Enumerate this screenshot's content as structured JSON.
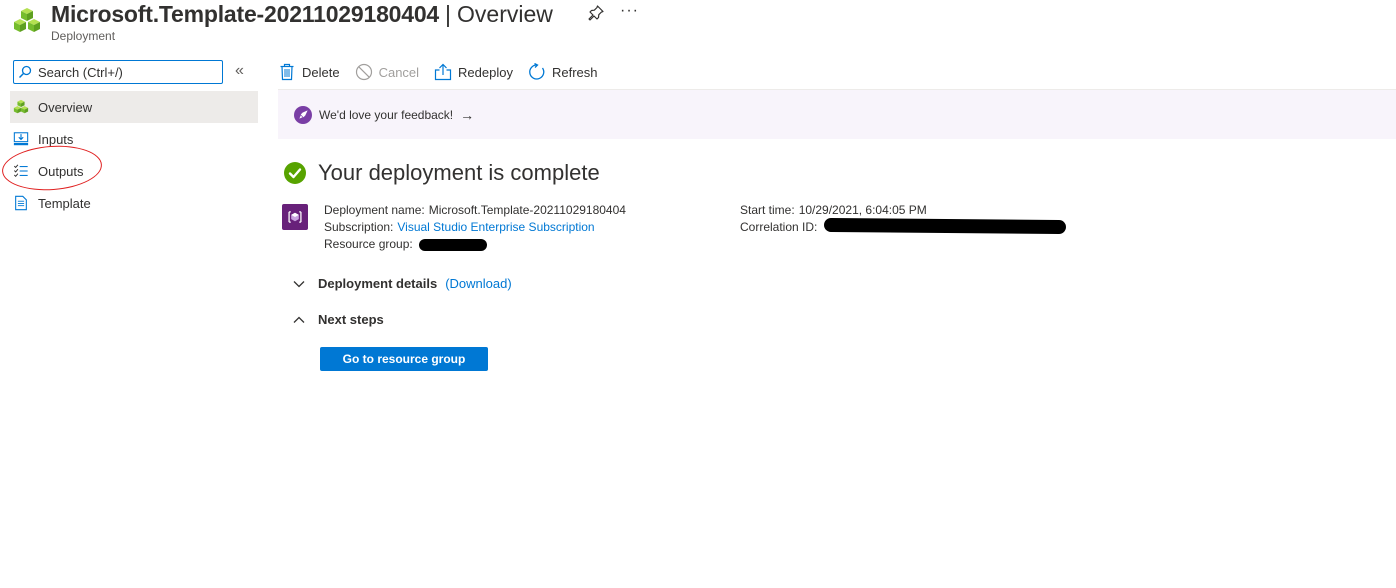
{
  "header": {
    "title": "Microsoft.Template-20211029180404",
    "separator": "|",
    "section": "Overview",
    "subtitle": "Deployment",
    "more": "···"
  },
  "sidebar": {
    "search_placeholder": "Search (Ctrl+/)",
    "collapse": "«",
    "items": [
      {
        "label": "Overview",
        "icon": "deployment-icon",
        "active": true
      },
      {
        "label": "Inputs",
        "icon": "inputs-icon",
        "active": false
      },
      {
        "label": "Outputs",
        "icon": "outputs-icon",
        "active": false
      },
      {
        "label": "Template",
        "icon": "template-icon",
        "active": false
      }
    ]
  },
  "toolbar": {
    "delete": "Delete",
    "cancel": "Cancel",
    "redeploy": "Redeploy",
    "refresh": "Refresh"
  },
  "feedback": {
    "text": "We'd love your feedback!",
    "arrow": "→"
  },
  "main": {
    "status_title": "Your deployment is complete",
    "deployment_name_label": "Deployment name:",
    "deployment_name": "Microsoft.Template-20211029180404",
    "subscription_label": "Subscription:",
    "subscription": "Visual Studio Enterprise Subscription",
    "resource_group_label": "Resource group:",
    "start_time_label": "Start time:",
    "start_time": "10/29/2021, 6:04:05 PM",
    "correlation_id_label": "Correlation ID:",
    "deployment_details_label": "Deployment details",
    "download_link": "(Download)",
    "next_steps_label": "Next steps",
    "go_to_rg_button": "Go to resource group"
  },
  "colors": {
    "accent": "#0078d4",
    "success": "#57a300",
    "feedback_bg": "#f8f4fb",
    "annotation": "#e02020"
  }
}
